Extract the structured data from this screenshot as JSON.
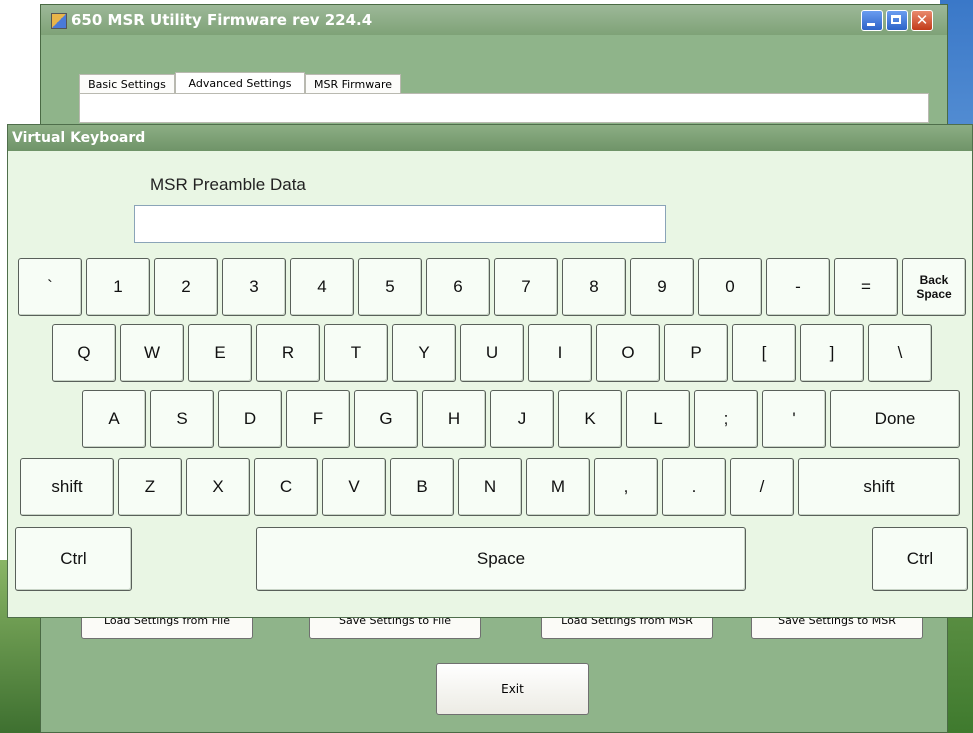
{
  "app": {
    "title": "650 MSR Utility  Firmware rev 224.4",
    "tabs": [
      "Basic Settings",
      "Advanced Settings",
      "MSR Firmware"
    ],
    "buttons": {
      "load_file": "Load Settings from File",
      "save_file": "Save Settings to File",
      "load_msr": "Load Settings from MSR",
      "save_msr": "Save Settings to MSR",
      "exit": "Exit"
    }
  },
  "keyboard": {
    "title": "Virtual Keyboard",
    "field_label": "MSR Preamble Data",
    "field_value": "",
    "rows": [
      [
        "`",
        "1",
        "2",
        "3",
        "4",
        "5",
        "6",
        "7",
        "8",
        "9",
        "0",
        "-",
        "=",
        "Back\nSpace"
      ],
      [
        "Q",
        "W",
        "E",
        "R",
        "T",
        "Y",
        "U",
        "I",
        "O",
        "P",
        "[",
        "]",
        "\\"
      ],
      [
        "A",
        "S",
        "D",
        "F",
        "G",
        "H",
        "J",
        "K",
        "L",
        ";",
        "'",
        "Done"
      ],
      [
        "shift",
        "Z",
        "X",
        "C",
        "V",
        "B",
        "N",
        "M",
        ",",
        ".",
        "/",
        "shift"
      ],
      [
        "Ctrl",
        "Space",
        "Ctrl"
      ]
    ]
  }
}
